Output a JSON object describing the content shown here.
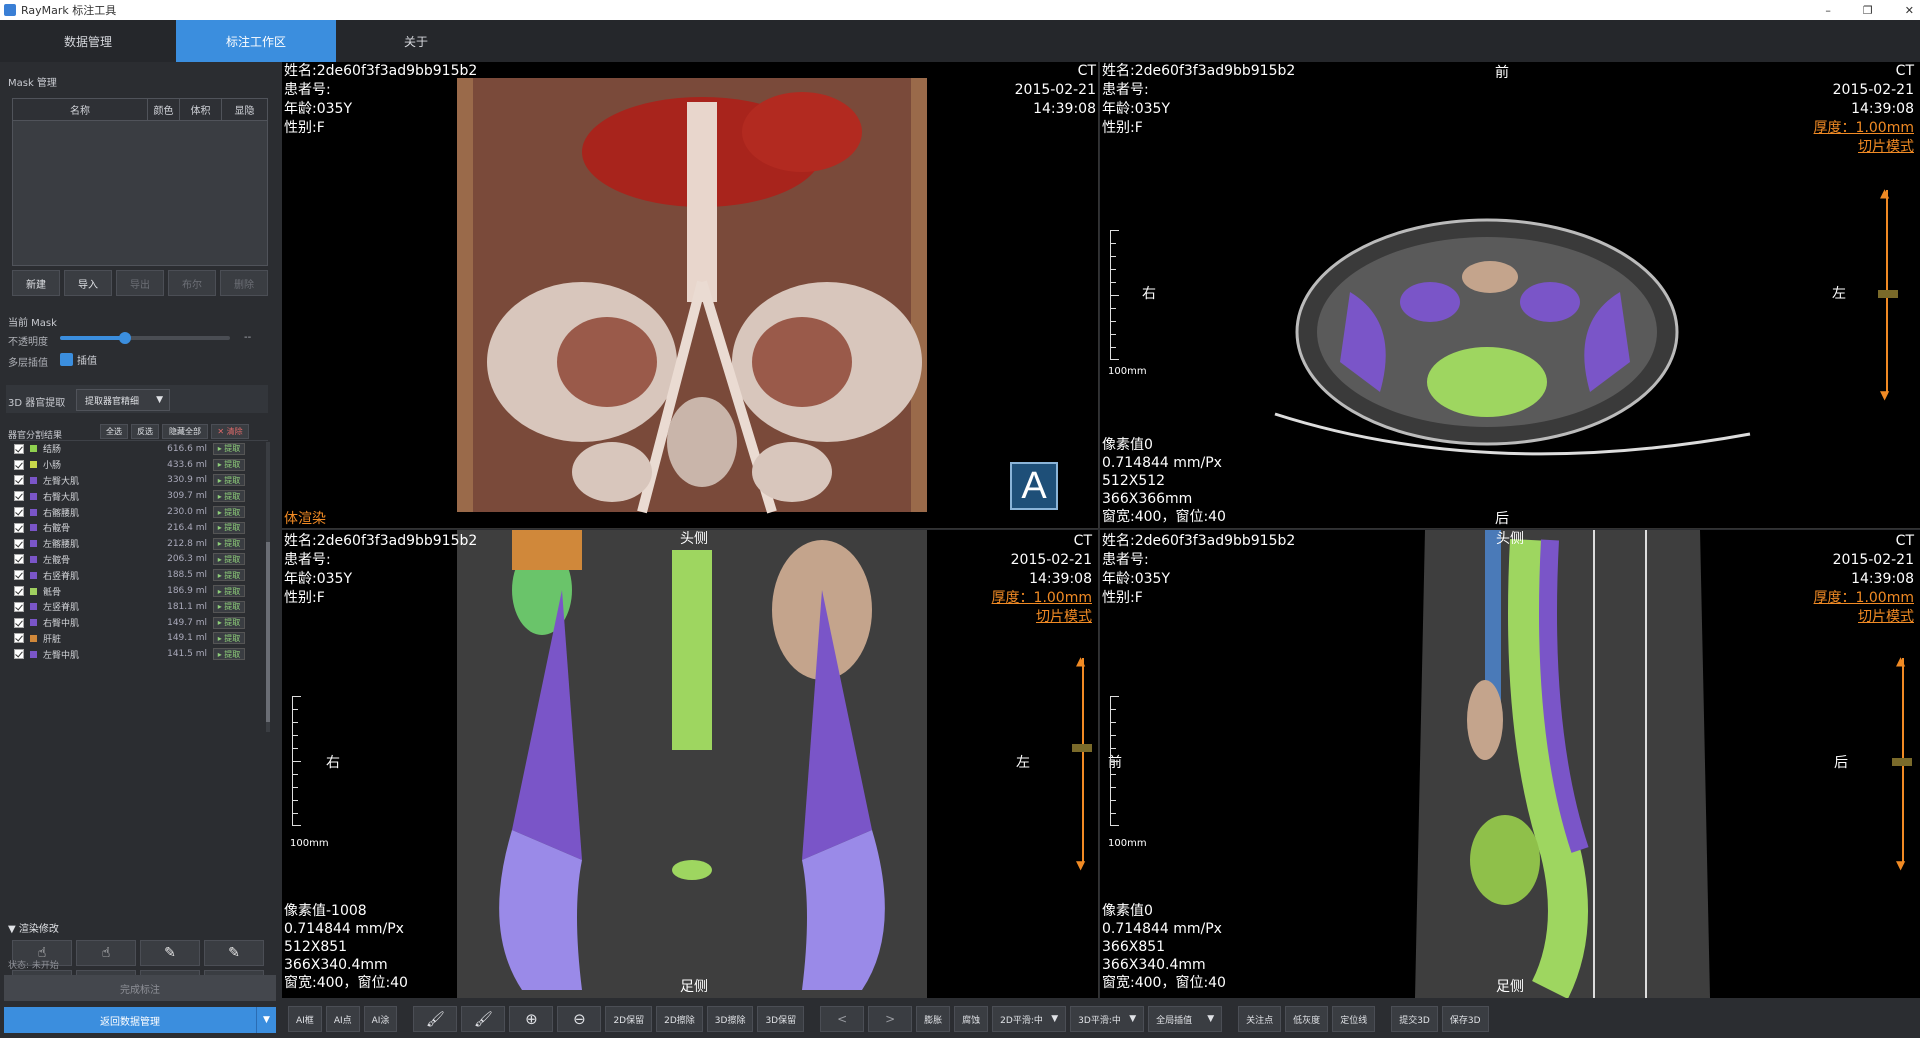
{
  "app": {
    "title": "RayMark 标注工具"
  },
  "window": {
    "minimize": "–",
    "restore": "❐",
    "close": "✕"
  },
  "nav": {
    "tabs": [
      {
        "label": "数据管理"
      },
      {
        "label": "标注工作区"
      },
      {
        "label": "关于"
      }
    ]
  },
  "mask": {
    "section_title": "Mask 管理",
    "headers": {
      "name": "名称",
      "color": "颜色",
      "volume": "体积",
      "show": "显隐"
    },
    "buttons": {
      "new": "新建",
      "import": "导入",
      "export": "导出",
      "boolean": "布尔",
      "delete": "删除"
    }
  },
  "current_mask": {
    "title": "当前 Mask",
    "opacity_label": "不透明度",
    "opacity_value": "--",
    "opacity": 0.38,
    "interp_label": "多层插值",
    "interp_check_label": "插值"
  },
  "organ3d": {
    "title": "3D 器官提取",
    "dropdown": "提取器官精细"
  },
  "results": {
    "title": "器官分割结果",
    "btn_select_all": "全选",
    "btn_invert": "反选",
    "btn_hide_all": "隐藏全部",
    "btn_clear": "✕ 清除",
    "extract_label": "▸ 提取",
    "items": [
      {
        "name": "结肠",
        "volume": "616.6 ml",
        "color": "#8fd14f"
      },
      {
        "name": "小肠",
        "volume": "433.6 ml",
        "color": "#c8d84a"
      },
      {
        "name": "左臀大肌",
        "volume": "330.9 ml",
        "color": "#7a55c8"
      },
      {
        "name": "右臀大肌",
        "volume": "309.7 ml",
        "color": "#7a55c8"
      },
      {
        "name": "右髂腰肌",
        "volume": "230.0 ml",
        "color": "#7a55c8"
      },
      {
        "name": "右髋骨",
        "volume": "216.4 ml",
        "color": "#7a55c8"
      },
      {
        "name": "左髂腰肌",
        "volume": "212.8 ml",
        "color": "#7a55c8"
      },
      {
        "name": "左髋骨",
        "volume": "206.3 ml",
        "color": "#7a55c8"
      },
      {
        "name": "右竖脊肌",
        "volume": "188.5 ml",
        "color": "#7a55c8"
      },
      {
        "name": "骶骨",
        "volume": "186.9 ml",
        "color": "#a0d060"
      },
      {
        "name": "左竖脊肌",
        "volume": "181.1 ml",
        "color": "#7a55c8"
      },
      {
        "name": "右臀中肌",
        "volume": "149.7 ml",
        "color": "#7a55c8"
      },
      {
        "name": "肝脏",
        "volume": "149.1 ml",
        "color": "#d0883a"
      },
      {
        "name": "左臀中肌",
        "volume": "141.5 ml",
        "color": "#7a55c8"
      }
    ]
  },
  "render_edit": {
    "title": "▼ 渲染修改"
  },
  "status": {
    "text": "状态: 未开始",
    "complete_btn": "完成标注",
    "return_btn": "返回数据管理"
  },
  "views": {
    "v3d": {
      "name": "姓名:2de60f3f3ad9bb915b2",
      "id": "患者号:",
      "age": "年龄:035Y",
      "sex": "性别:F",
      "modality": "CT",
      "date": "2015-02-21",
      "time": "14:39:08",
      "label": "体渲染",
      "orientation": "A"
    },
    "axial": {
      "name": "姓名:2de60f3f3ad9bb915b2",
      "id": "患者号:",
      "age": "年龄:035Y",
      "sex": "性别:F",
      "modality": "CT",
      "date": "2015-02-21",
      "time": "14:39:08",
      "thickness": "厚度：1.00mm",
      "mode": "切片模式",
      "top": "前",
      "bottom": "后",
      "left": "右",
      "right": "左",
      "scale": "100mm",
      "pixel": "像素值0",
      "spacing": "0.714844 mm/Px",
      "dims": "512X512",
      "size": "366X366mm",
      "window": "窗宽:400，窗位:40"
    },
    "coronal": {
      "name": "姓名:2de60f3f3ad9bb915b2",
      "id": "患者号:",
      "age": "年龄:035Y",
      "sex": "性别:F",
      "modality": "CT",
      "date": "2015-02-21",
      "time": "14:39:08",
      "thickness": "厚度：1.00mm",
      "mode": "切片模式",
      "top": "头侧",
      "bottom": "足侧",
      "left": "右",
      "right": "左",
      "scale": "100mm",
      "pixel": "像素值-1008",
      "spacing": "0.714844 mm/Px",
      "dims": "512X851",
      "size": "366X340.4mm",
      "window": "窗宽:400，窗位:40"
    },
    "sagittal": {
      "name": "姓名:2de60f3f3ad9bb915b2",
      "id": "患者号:",
      "age": "年龄:035Y",
      "sex": "性别:F",
      "modality": "CT",
      "date": "2015-02-21",
      "time": "14:39:08",
      "thickness": "厚度：1.00mm",
      "mode": "切片模式",
      "top": "头侧",
      "bottom": "足侧",
      "left": "前",
      "right": "后",
      "scale": "100mm",
      "pixel": "像素值0",
      "spacing": "0.714844 mm/Px",
      "dims": "366X851",
      "size": "366X340.4mm",
      "window": "窗宽:400，窗位:40"
    }
  },
  "toolbar": {
    "ai_box": "AI框",
    "ai_point": "AI点",
    "ai_paint": "AI涂",
    "keep2d": "2D保留",
    "erase2d": "2D擦除",
    "erase3d": "3D擦除",
    "keep3d": "3D保留",
    "dilate": "膨胀",
    "erode": "腐蚀",
    "smooth2d": "2D平滑:中",
    "smooth3d": "3D平滑:中",
    "global_interp": "全局插值",
    "focus": "关注点",
    "low_gray": "低灰度",
    "locate": "定位线",
    "submit3d": "提交3D",
    "save3d": "保存3D"
  }
}
